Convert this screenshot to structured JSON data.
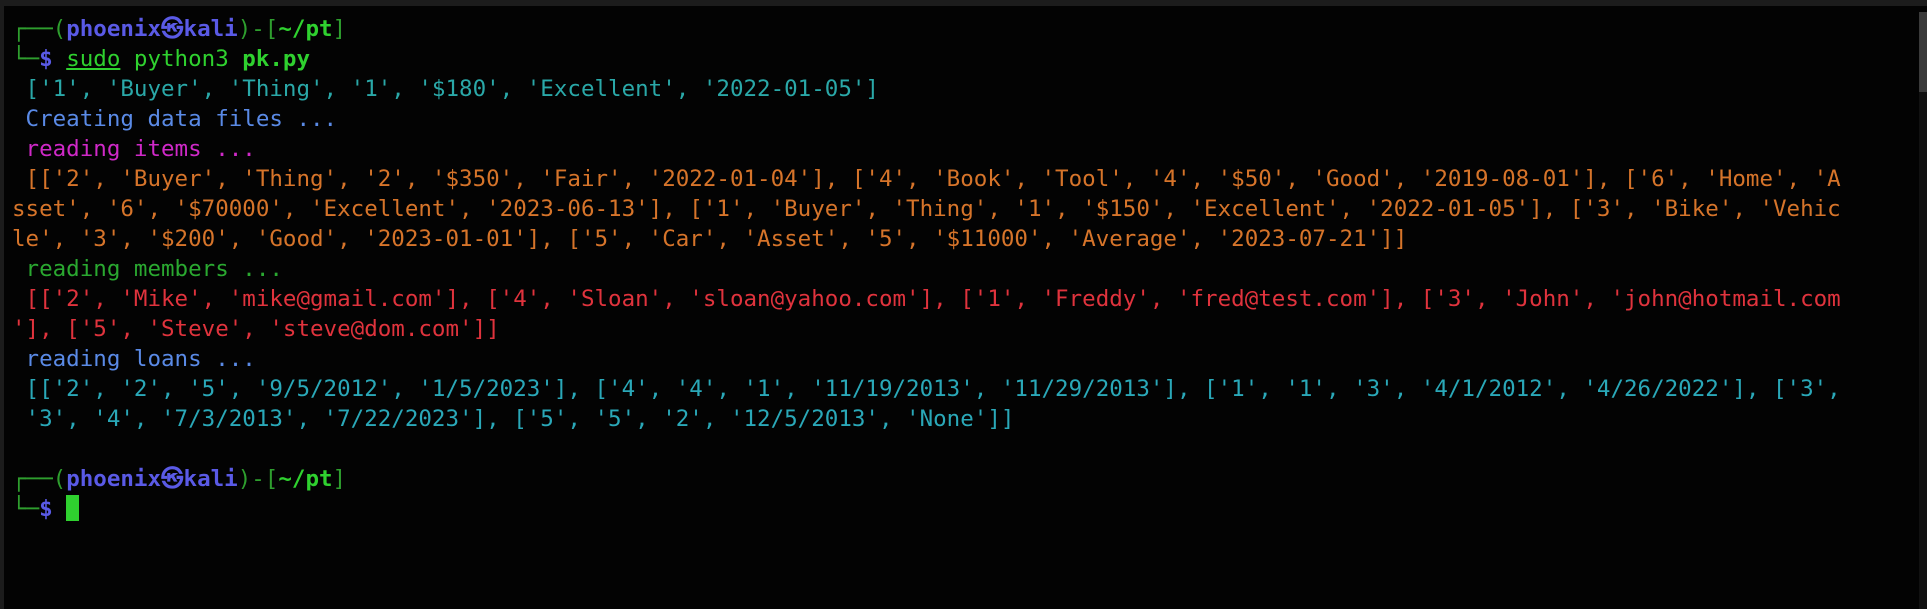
{
  "prompt1": {
    "box_top": "┌──(",
    "user": "phoenix",
    "sep": "㉿",
    "host": "kali",
    "mid": ")-[",
    "path": "~/pt",
    "end": "]",
    "box_bottom": "└─",
    "dollar": "$",
    "sudo": "sudo",
    "cmd": "python3",
    "script": "pk.py"
  },
  "output": {
    "line1": " ['1', 'Buyer', 'Thing', '1', '$180', 'Excellent', '2022-01-05']",
    "creating": " Creating data files ...",
    "reading_items": " reading items ...",
    "items_1": " [['2', 'Buyer', 'Thing', '2', '$350', 'Fair', '2022-01-04'], ['4', 'Book', 'Tool', '4', '$50', 'Good', '2019-08-01'], ['6', 'Home', 'A",
    "items_2": "sset', '6', '$70000', 'Excellent', '2023-06-13'], ['1', 'Buyer', 'Thing', '1', '$150', 'Excellent', '2022-01-05'], ['3', 'Bike', 'Vehic",
    "items_3": "le', '3', '$200', 'Good', '2023-01-01'], ['5', 'Car', 'Asset', '5', '$11000', 'Average', '2023-07-21']]",
    "reading_members": " reading members ...",
    "members_1": " [['2', 'Mike', 'mike@gmail.com'], ['4', 'Sloan', 'sloan@yahoo.com'], ['1', 'Freddy', 'fred@test.com'], ['3', 'John', 'john@hotmail.com",
    "members_2": "'], ['5', 'Steve', 'steve@dom.com']]",
    "reading_loans": " reading loans ...",
    "loans_1": " [['2', '2', '5', '9/5/2012', '1/5/2023'], ['4', '4', '1', '11/19/2013', '11/29/2013'], ['1', '1', '3', '4/1/2012', '4/26/2022'], ['3',",
    "loans_2": " '3', '4', '7/3/2013', '7/22/2023'], ['5', '5', '2', '12/5/2013', 'None']]"
  },
  "prompt2": {
    "box_top": "┌──(",
    "user": "phoenix",
    "sep": "㉿",
    "host": "kali",
    "mid": ")-[",
    "path": "~/pt",
    "end": "]",
    "box_bottom": "└─",
    "dollar": "$"
  },
  "colors": {
    "background": "#030303",
    "prompt_box": "#2e9e2e",
    "user_host": "#5a5ae6",
    "path": "#2fd12f",
    "items": "#d6742a",
    "members_data": "#e0333d",
    "loans_data": "#2aa8b8"
  }
}
